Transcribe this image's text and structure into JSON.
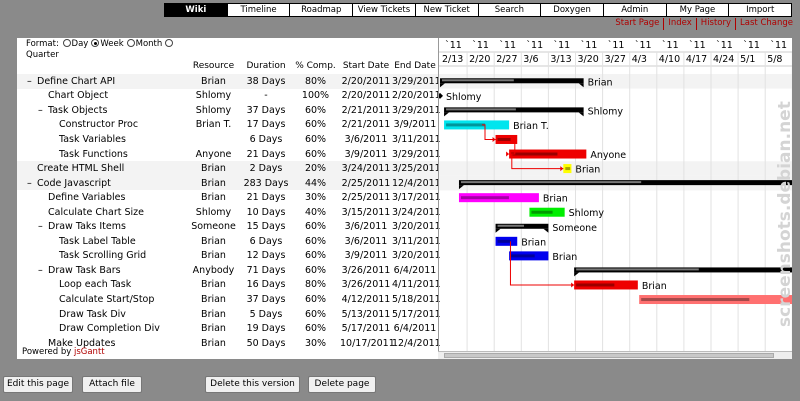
{
  "nav": [
    "Wiki",
    "Timeline",
    "Roadmap",
    "View Tickets",
    "New Ticket",
    "Search",
    "Doxygen",
    "Admin",
    "My Page",
    "Import"
  ],
  "nav_active": 0,
  "metanav": [
    "Start Page",
    "Index",
    "History",
    "Last Change"
  ],
  "format": {
    "label": "Format:",
    "options": [
      {
        "label": "Day",
        "selected": false
      },
      {
        "label": "Week",
        "selected": true
      },
      {
        "label": "Month",
        "selected": false
      }
    ],
    "line2": "Quarter"
  },
  "columns": {
    "resource": "Resource",
    "duration": "Duration",
    "pct": "% Comp.",
    "start": "Start Date",
    "end": "End Date"
  },
  "tasks": [
    {
      "level": 0,
      "toggle": "–",
      "name": "Define Chart API",
      "resource": "Brian",
      "duration": "38 Days",
      "pct": "80%",
      "start": "2/20/2011",
      "end": "3/29/2011",
      "bar": {
        "kind": "group",
        "from": 0,
        "to": 5.3,
        "label": "Brian"
      }
    },
    {
      "level": 1,
      "toggle": "",
      "name": "Chart Object",
      "resource": "Shlomy",
      "duration": "-",
      "pct": "100%",
      "start": "2/20/2011",
      "end": "2/20/2011",
      "bar": {
        "kind": "milestone",
        "from": 0,
        "label": "Shlomy"
      }
    },
    {
      "level": 1,
      "toggle": "–",
      "name": "Task Objects",
      "resource": "Shlomy",
      "duration": "37 Days",
      "pct": "60%",
      "start": "2/21/2011",
      "end": "3/29/2011",
      "bar": {
        "kind": "group",
        "from": 0.15,
        "to": 5.3,
        "label": "Shlomy"
      }
    },
    {
      "level": 2,
      "toggle": "",
      "name": "Constructor Proc",
      "resource": "Brian T.",
      "duration": "17 Days",
      "pct": "60%",
      "start": "2/21/2011",
      "end": "3/9/2011",
      "bar": {
        "kind": "task",
        "from": 0.15,
        "to": 2.55,
        "color": "#00e5ee",
        "label": "Brian T."
      }
    },
    {
      "level": 2,
      "toggle": "",
      "name": "Task Variables",
      "resource": "",
      "duration": "6 Days",
      "pct": "60%",
      "start": "3/6/2011",
      "end": "3/11/2011",
      "bar": {
        "kind": "task",
        "from": 2.05,
        "to": 2.85,
        "color": "#ee0000",
        "label": ""
      }
    },
    {
      "level": 2,
      "toggle": "",
      "name": "Task Functions",
      "resource": "Anyone",
      "duration": "21 Days",
      "pct": "60%",
      "start": "3/9/2011",
      "end": "3/29/2011",
      "bar": {
        "kind": "task",
        "from": 2.55,
        "to": 5.4,
        "color": "#ee0000",
        "label": "Anyone"
      }
    },
    {
      "level": 0,
      "toggle": "",
      "name": "Create HTML Shell",
      "resource": "Brian",
      "duration": "2 Days",
      "pct": "20%",
      "start": "3/24/2011",
      "end": "3/25/2011",
      "bar": {
        "kind": "task",
        "from": 4.55,
        "to": 4.85,
        "color": "#ffff00",
        "label": "Brian"
      }
    },
    {
      "level": 0,
      "toggle": "–",
      "name": "Code Javascript",
      "resource": "Brian",
      "duration": "283 Days",
      "pct": "44%",
      "start": "2/25/2011",
      "end": "12/4/2011",
      "bar": {
        "kind": "group",
        "from": 0.7,
        "to": 14,
        "label": ""
      }
    },
    {
      "level": 1,
      "toggle": "",
      "name": "Define Variables",
      "resource": "Brian",
      "duration": "21 Days",
      "pct": "30%",
      "start": "2/25/2011",
      "end": "3/17/2011",
      "bar": {
        "kind": "task",
        "from": 0.7,
        "to": 3.65,
        "color": "#ff00ff",
        "label": "Brian"
      }
    },
    {
      "level": 1,
      "toggle": "",
      "name": "Calculate Chart Size",
      "resource": "Shlomy",
      "duration": "10 Days",
      "pct": "40%",
      "start": "3/15/2011",
      "end": "3/24/2011",
      "bar": {
        "kind": "task",
        "from": 3.3,
        "to": 4.6,
        "color": "#00ee00",
        "label": "Shlomy"
      }
    },
    {
      "level": 1,
      "toggle": "–",
      "name": "Draw Taks Items",
      "resource": "Someone",
      "duration": "15 Days",
      "pct": "60%",
      "start": "3/6/2011",
      "end": "3/20/2011",
      "bar": {
        "kind": "group",
        "from": 2.05,
        "to": 4.0,
        "label": "Someone"
      }
    },
    {
      "level": 2,
      "toggle": "",
      "name": "Task Label Table",
      "resource": "Brian",
      "duration": "6 Days",
      "pct": "60%",
      "start": "3/6/2011",
      "end": "3/11/2011",
      "bar": {
        "kind": "task",
        "from": 2.05,
        "to": 2.85,
        "color": "#0000ee",
        "label": "Brian"
      }
    },
    {
      "level": 2,
      "toggle": "",
      "name": "Task Scrolling Grid",
      "resource": "Brian",
      "duration": "12 Days",
      "pct": "60%",
      "start": "3/9/2011",
      "end": "3/20/2011",
      "bar": {
        "kind": "task",
        "from": 2.55,
        "to": 4.0,
        "color": "#0000ee",
        "label": "Brian"
      }
    },
    {
      "level": 1,
      "toggle": "–",
      "name": "Draw Task Bars",
      "resource": "Anybody",
      "duration": "71 Days",
      "pct": "60%",
      "start": "3/26/2011",
      "end": "6/4/2011",
      "bar": {
        "kind": "group",
        "from": 4.95,
        "to": 14,
        "label": ""
      }
    },
    {
      "level": 2,
      "toggle": "",
      "name": "Loop each Task",
      "resource": "Brian",
      "duration": "16 Days",
      "pct": "80%",
      "start": "3/26/2011",
      "end": "4/11/2011",
      "bar": {
        "kind": "task",
        "from": 4.95,
        "to": 7.3,
        "color": "#ee0000",
        "label": "Brian"
      }
    },
    {
      "level": 2,
      "toggle": "",
      "name": "Calculate Start/Stop",
      "resource": "Brian",
      "duration": "37 Days",
      "pct": "60%",
      "start": "4/12/2011",
      "end": "5/18/2011",
      "bar": {
        "kind": "task",
        "from": 7.35,
        "to": 14,
        "color": "#ff7070",
        "label": ""
      }
    },
    {
      "level": 2,
      "toggle": "",
      "name": "Draw Task Div",
      "resource": "Brian",
      "duration": "5 Days",
      "pct": "60%",
      "start": "5/13/2011",
      "end": "5/17/2011",
      "bar": null
    },
    {
      "level": 2,
      "toggle": "",
      "name": "Draw Completion Div",
      "resource": "Brian",
      "duration": "19 Days",
      "pct": "60%",
      "start": "5/17/2011",
      "end": "6/4/2011",
      "bar": null
    },
    {
      "level": 1,
      "toggle": "",
      "name": "Make Updates",
      "resource": "Brian",
      "duration": "50 Days",
      "pct": "30%",
      "start": "10/17/2011",
      "end": "12/4/2011",
      "bar": null
    }
  ],
  "timeline": {
    "years": [
      "`11",
      "`11",
      "`11",
      "`11",
      "`11",
      "`11",
      "`11",
      "`11",
      "`11",
      "`11",
      "`11",
      "`11",
      "`11",
      "`11"
    ],
    "weeks": [
      "2/13",
      "2/20",
      "2/27",
      "3/6",
      "3/13",
      "3/20",
      "3/27",
      "4/3",
      "4/10",
      "4/17",
      "4/24",
      "5/1",
      "5/8"
    ]
  },
  "powered_by": {
    "prefix": "Powered by",
    "link": "jsGantt"
  },
  "watermark": "screenshots.debian.net",
  "buttons": [
    "Edit this page",
    "Attach file",
    "Delete this version",
    "Delete page"
  ]
}
